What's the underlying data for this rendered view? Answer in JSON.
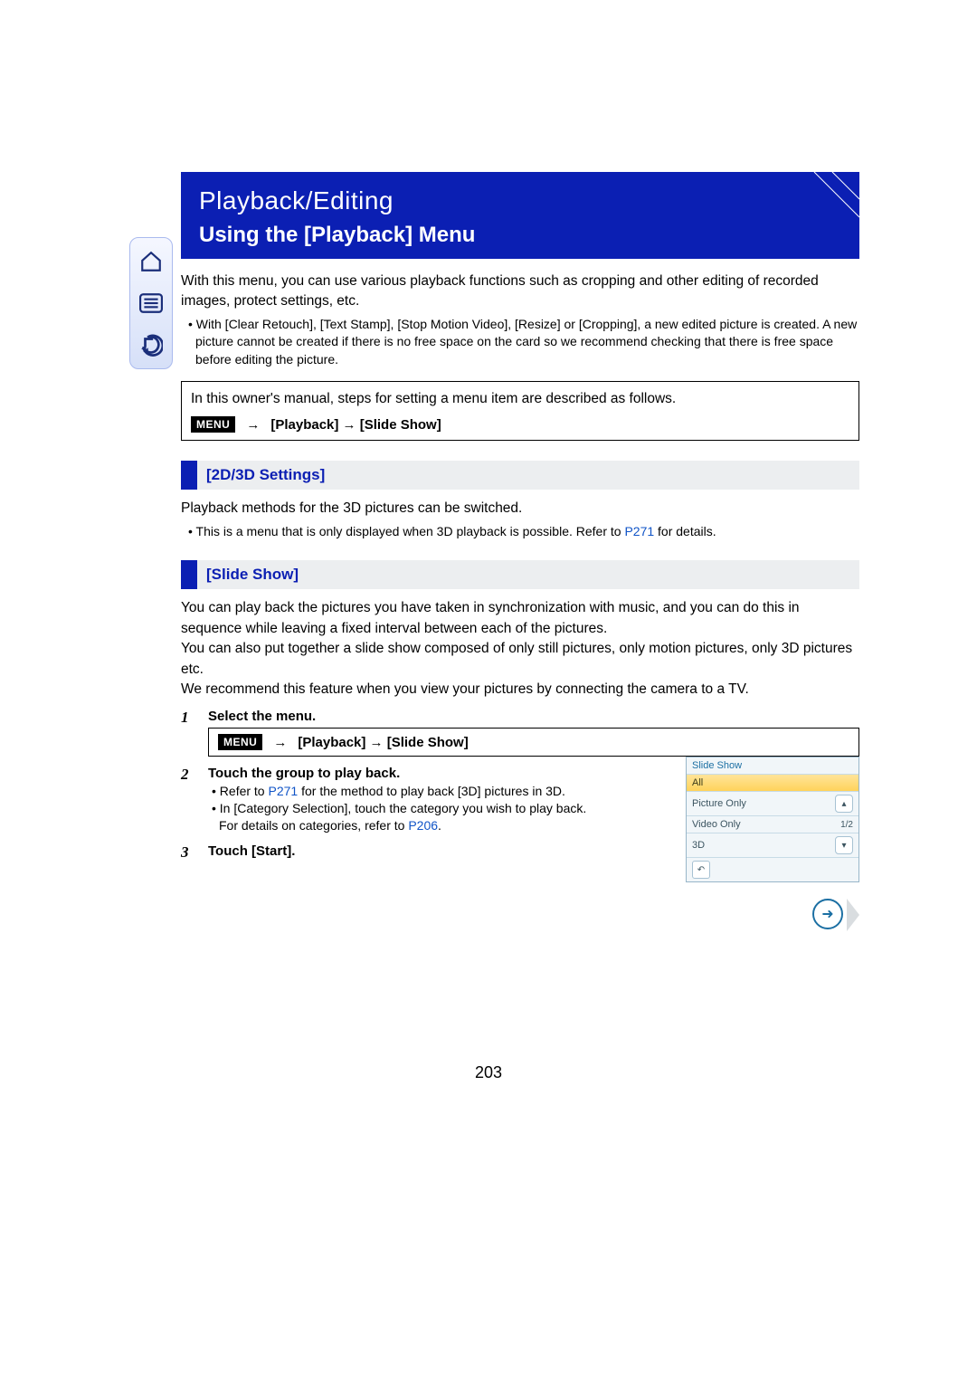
{
  "nav": {
    "home_label": "home-icon",
    "menu_label": "menu-icon",
    "back_label": "back-icon"
  },
  "header": {
    "section": "Playback/Editing",
    "title": "Using the [Playback] Menu"
  },
  "intro": "With this menu, you can use various playback functions such as cropping and other editing of recorded images, protect settings, etc.",
  "intro_bullet": "With [Clear Retouch], [Text Stamp], [Stop Motion Video], [Resize] or [Cropping], a new edited picture is created. A new picture cannot be created if there is no free space on the card so we recommend checking that there is free space before editing the picture.",
  "note_box": {
    "line": "In this owner's manual, steps for setting a menu item are described as follows.",
    "menu_tag": "MENU",
    "path": "  [Playback] → [Slide Show]"
  },
  "sections": {
    "s1": {
      "title": "[2D/3D Settings]",
      "body": "Playback methods for the 3D pictures can be switched.",
      "bullet_pre": "This is a menu that is only displayed when 3D playback is possible. Refer to ",
      "bullet_link": "P271",
      "bullet_post": " for details."
    },
    "s2": {
      "title": "[Slide Show]",
      "p1": "You can play back the pictures you have taken in synchronization with music, and you can do this in sequence while leaving a fixed interval between each of the pictures.",
      "p2": "You can also put together a slide show composed of only still pictures, only motion pictures, only 3D pictures etc.",
      "p3": "We recommend this feature when you view your pictures by connecting the camera to a TV."
    }
  },
  "steps": {
    "n1": "1",
    "t1": "Select the menu.",
    "menu_tag": "MENU",
    "path1": "  [Playback] → [Slide Show]",
    "n2": "2",
    "t2": "Touch the group to play back.",
    "b2a_pre": "Refer to ",
    "b2a_link": "P271",
    "b2a_post": " for the method to play back [3D] pictures in 3D.",
    "b2b": "In [Category Selection], touch the category you wish to play back.",
    "b2c_pre": "For details on categories, refer to ",
    "b2c_link": "P206",
    "b2c_post": ".",
    "n3": "3",
    "t3": "Touch [Start]."
  },
  "thumb": {
    "header": "Slide Show",
    "i1": "All",
    "i2": "Picture Only",
    "i3": "Video Only",
    "i4": "3D",
    "page": "1/2"
  },
  "page_number": "203",
  "arrow": "→"
}
